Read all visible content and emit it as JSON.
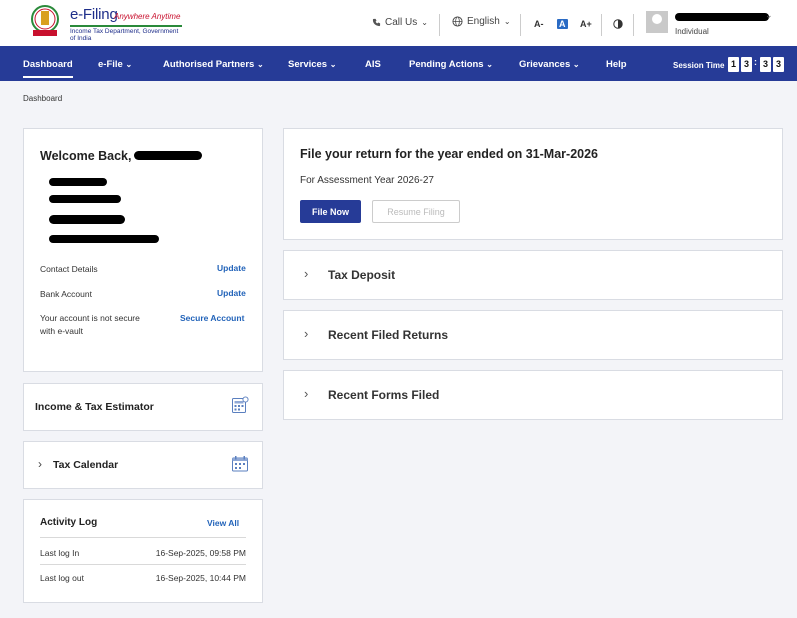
{
  "header": {
    "brand_title": "e-Filing",
    "brand_tagline": "Anywhere Anytime",
    "brand_subtitle": "Income Tax Department, Government of India",
    "call_us": "Call Us",
    "language": "English",
    "font_decrease": "A-",
    "font_normal": "A",
    "font_increase": "A+",
    "user_role": "Individual"
  },
  "nav": {
    "items": [
      {
        "label": "Dashboard",
        "active": true
      },
      {
        "label": "e-File",
        "dropdown": true
      },
      {
        "label": "Authorised Partners",
        "dropdown": true
      },
      {
        "label": "Services",
        "dropdown": true
      },
      {
        "label": "AIS"
      },
      {
        "label": "Pending Actions",
        "dropdown": true
      },
      {
        "label": "Grievances",
        "dropdown": true
      },
      {
        "label": "Help"
      }
    ],
    "session_label": "Session Time",
    "session_digits": [
      "1",
      "3",
      ":",
      "3",
      "3"
    ]
  },
  "breadcrumb": "Dashboard",
  "welcome": {
    "title": "Welcome Back,",
    "contact_label": "Contact Details",
    "contact_action": "Update",
    "bank_label": "Bank Account",
    "bank_action": "Update",
    "evault_label": "Your account is not secure with e-vault",
    "evault_action": "Secure Account"
  },
  "estimator": {
    "title": "Income & Tax Estimator"
  },
  "calendar": {
    "title": "Tax Calendar"
  },
  "activity": {
    "title": "Activity Log",
    "view_all": "View All",
    "rows": [
      {
        "label": "Last log In",
        "value": "16-Sep-2025, 09:58 PM"
      },
      {
        "label": "Last log out",
        "value": "16-Sep-2025, 10:44 PM"
      }
    ]
  },
  "file_return": {
    "title": "File your return for the year ended on 31-Mar-2026",
    "subtitle": "For Assessment Year 2026-27",
    "primary_button": "File Now",
    "secondary_button": "Resume Filing"
  },
  "accordions": [
    {
      "title": "Tax Deposit"
    },
    {
      "title": "Recent Filed Returns"
    },
    {
      "title": "Recent Forms Filed"
    }
  ],
  "colors": {
    "nav_bg": "#263b97",
    "link": "#2263b9",
    "accent_red": "#c8102e"
  }
}
